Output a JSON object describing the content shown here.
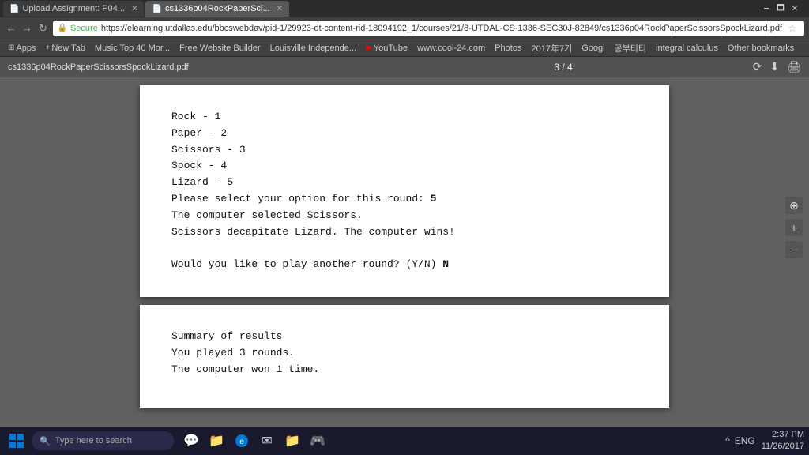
{
  "titlebar": {
    "tabs": [
      {
        "id": "tab1",
        "label": "Upload Assignment: P04...",
        "active": false,
        "closable": true
      },
      {
        "id": "tab2",
        "label": "cs1336p04RockPaperSci...",
        "active": true,
        "closable": true
      }
    ],
    "controls": [
      "minimize",
      "maximize",
      "close"
    ]
  },
  "addressbar": {
    "secure_label": "Secure",
    "url": "https://elearning.utdallas.edu/bbcswebdav/pid-1/29923-dt-content-rid-18094192_1/courses/21/8-UTDAL-CS-1336-SEC30J-82849/cs1336p04RockPaperScissorsSpockLizard.pdf",
    "nav": {
      "back": "←",
      "forward": "→",
      "refresh": "↻"
    }
  },
  "bookmarks": {
    "items": [
      {
        "label": "Apps",
        "icon": "⊞"
      },
      {
        "label": "New Tab",
        "icon": "+"
      },
      {
        "label": "Music Top 40 Mor...",
        "icon": "♪"
      },
      {
        "label": "Free Website Builder",
        "icon": "W"
      },
      {
        "label": "Louisville Independe...",
        "icon": "📰"
      },
      {
        "label": "YouTube",
        "icon": "▶"
      },
      {
        "label": "www.cool-24.com",
        "icon": "🌐"
      },
      {
        "label": "Photos",
        "icon": "🖼"
      },
      {
        "label": "2017年7기",
        "icon": "📅"
      },
      {
        "label": "Googl",
        "icon": "G"
      },
      {
        "label": "공부티티",
        "icon": "📖"
      },
      {
        "label": "integral calculus",
        "icon": "∫"
      },
      {
        "label": "Other bookmarks",
        "icon": "»"
      }
    ]
  },
  "pdf_toolbar": {
    "filename": "cs1336p04RockPaperScissorsSpockLizard.pdf",
    "page_info": "3 / 4",
    "buttons": {
      "rotate": "⟳",
      "download": "⬇",
      "print": "🖨"
    }
  },
  "page1": {
    "lines": [
      {
        "text": "Rock - 1",
        "bold": false
      },
      {
        "text": "Paper - 2",
        "bold": false
      },
      {
        "text": "Scissors - 3",
        "bold": false
      },
      {
        "text": "Spock - 4",
        "bold": false
      },
      {
        "text": "Lizard - 5",
        "bold": false
      },
      {
        "text": "Please select your option for this round: ",
        "bold": false,
        "suffix": "5",
        "suffix_bold": true
      },
      {
        "text": "The computer selected Scissors.",
        "bold": false
      },
      {
        "text": "Scissors decapitate Lizard. The computer wins!",
        "bold": false
      },
      {
        "text": "",
        "bold": false
      },
      {
        "text": "Would you like to play another round? (Y/N) ",
        "bold": false,
        "suffix": "N",
        "suffix_bold": true
      }
    ]
  },
  "page2": {
    "lines": [
      {
        "text": "Summary of results",
        "bold": false
      },
      {
        "text": "You played 3 rounds.",
        "bold": false
      },
      {
        "text": "The computer won 1 time.",
        "bold": false
      }
    ]
  },
  "side_buttons": {
    "btn1": "⊕",
    "btn2": "+",
    "btn3": "−"
  },
  "taskbar": {
    "start_icon": "⊞",
    "search_placeholder": "Type here to search",
    "search_icon": "🔍",
    "icons": [
      "💬",
      "📁",
      "🌐",
      "✉",
      "📁",
      "🎮"
    ],
    "tray": {
      "icons": [
        "^",
        "ENG"
      ],
      "time": "2:37 PM",
      "date": "11/26/2017"
    }
  }
}
